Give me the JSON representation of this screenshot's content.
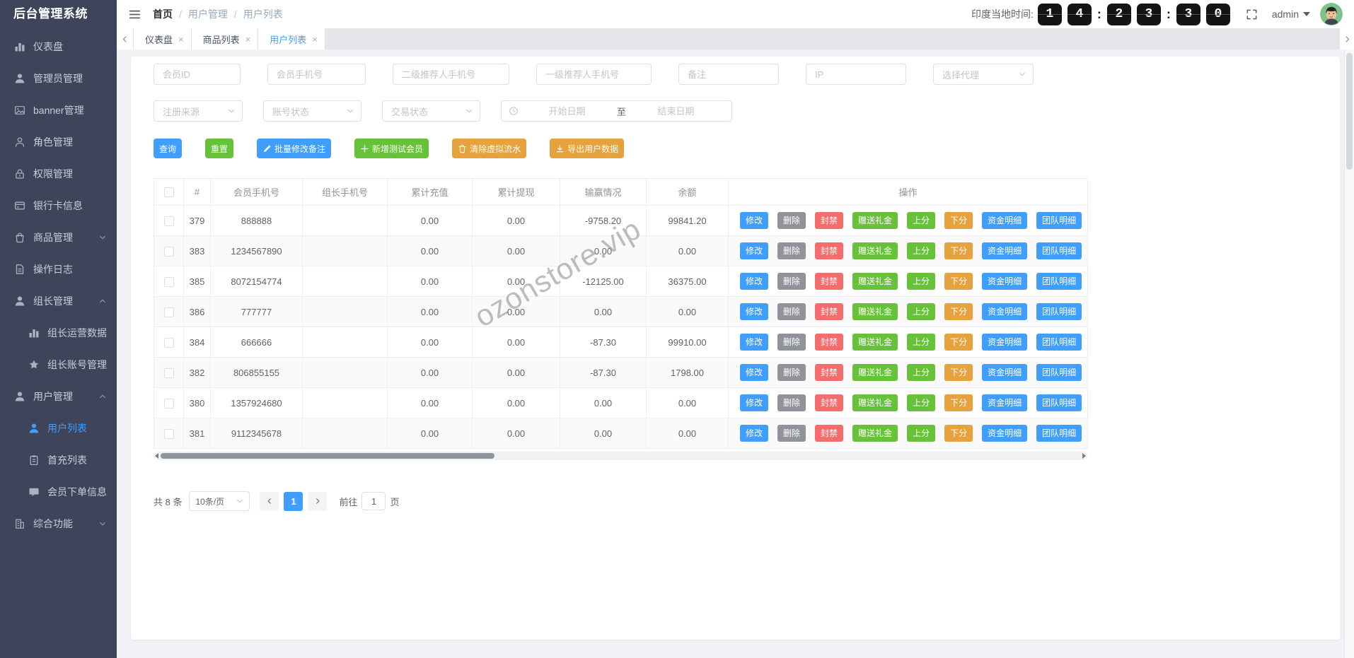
{
  "app": {
    "title": "后台管理系统"
  },
  "sidebar": {
    "items": [
      {
        "label": "仪表盘",
        "icon": "bar-chart-icon"
      },
      {
        "label": "管理员管理",
        "icon": "user-icon"
      },
      {
        "label": "banner管理",
        "icon": "image-icon"
      },
      {
        "label": "角色管理",
        "icon": "user-outline-icon"
      },
      {
        "label": "权限管理",
        "icon": "lock-icon"
      },
      {
        "label": "银行卡信息",
        "icon": "credit-card-icon"
      },
      {
        "label": "商品管理",
        "icon": "shopping-bag-icon",
        "chevron": "down"
      },
      {
        "label": "操作日志",
        "icon": "document-icon"
      },
      {
        "label": "组长管理",
        "icon": "user-icon",
        "chevron": "up"
      },
      {
        "label": "组长运营数据",
        "icon": "bar-chart-icon",
        "sub": true
      },
      {
        "label": "组长账号管理",
        "icon": "star-icon",
        "sub": true
      },
      {
        "label": "用户管理",
        "icon": "user-icon",
        "chevron": "up"
      },
      {
        "label": "用户列表",
        "icon": "user-icon",
        "sub": true,
        "active": true
      },
      {
        "label": "首充列表",
        "icon": "clipboard-icon",
        "sub": true
      },
      {
        "label": "会员下单信息",
        "icon": "message-icon",
        "sub": true
      },
      {
        "label": "综合功能",
        "icon": "building-icon",
        "chevron": "down"
      }
    ]
  },
  "header": {
    "breadcrumb": [
      "首页",
      "用户管理",
      "用户列表"
    ],
    "breadcrumb_separator": "/",
    "time_label": "印度当地时间:",
    "clock": {
      "groups": [
        [
          "1",
          "4"
        ],
        [
          "2",
          "3"
        ],
        [
          "3",
          "0"
        ]
      ],
      "separator": ":"
    },
    "username": "admin"
  },
  "tabs": [
    {
      "label": "仪表盘",
      "active": false
    },
    {
      "label": "商品列表",
      "active": false
    },
    {
      "label": "用户列表",
      "active": true
    }
  ],
  "filters": {
    "text_inputs": [
      "会员ID",
      "会员手机号",
      "二级推荐人手机号",
      "一级推荐人手机号",
      "备注",
      "IP"
    ],
    "agent_select": "选择代理",
    "selects": [
      "注册来源",
      "账号状态",
      "交易状态"
    ],
    "date_range": {
      "start_placeholder": "开始日期",
      "separator": "至",
      "end_placeholder": "结束日期"
    }
  },
  "toolbar": [
    {
      "label": "查询",
      "color": "blue",
      "icon": ""
    },
    {
      "label": "重置",
      "color": "green",
      "icon": ""
    },
    {
      "label": "批量修改备注",
      "color": "blue",
      "icon": "edit-icon"
    },
    {
      "label": "新增测试会员",
      "color": "green",
      "icon": "plus-icon"
    },
    {
      "label": "清除虚拟流水",
      "color": "orange",
      "icon": "trash-icon"
    },
    {
      "label": "导出用户数据",
      "color": "orange",
      "icon": "download-icon"
    }
  ],
  "table": {
    "columns": [
      "#",
      "会员手机号",
      "组长手机号",
      "累计充值",
      "累计提现",
      "输赢情况",
      "余额",
      "操作"
    ],
    "rows": [
      {
        "id": "379",
        "phone": "888888",
        "leader": "",
        "recharge": "0.00",
        "withdraw": "0.00",
        "winloss": "-9758.20",
        "balance": "99841.20"
      },
      {
        "id": "383",
        "phone": "1234567890",
        "leader": "",
        "recharge": "0.00",
        "withdraw": "0.00",
        "winloss": "0.00",
        "balance": "0.00"
      },
      {
        "id": "385",
        "phone": "8072154774",
        "leader": "",
        "recharge": "0.00",
        "withdraw": "0.00",
        "winloss": "-12125.00",
        "balance": "36375.00"
      },
      {
        "id": "386",
        "phone": "777777",
        "leader": "",
        "recharge": "0.00",
        "withdraw": "0.00",
        "winloss": "0.00",
        "balance": "0.00"
      },
      {
        "id": "384",
        "phone": "666666",
        "leader": "",
        "recharge": "0.00",
        "withdraw": "0.00",
        "winloss": "-87.30",
        "balance": "99910.00"
      },
      {
        "id": "382",
        "phone": "806855155",
        "leader": "",
        "recharge": "0.00",
        "withdraw": "0.00",
        "winloss": "-87.30",
        "balance": "1798.00"
      },
      {
        "id": "380",
        "phone": "1357924680",
        "leader": "",
        "recharge": "0.00",
        "withdraw": "0.00",
        "winloss": "0.00",
        "balance": "0.00"
      },
      {
        "id": "381",
        "phone": "9112345678",
        "leader": "",
        "recharge": "0.00",
        "withdraw": "0.00",
        "winloss": "0.00",
        "balance": "0.00"
      }
    ],
    "row_actions": [
      {
        "label": "修改",
        "color": "blue"
      },
      {
        "label": "删除",
        "color": "gray"
      },
      {
        "label": "封禁",
        "color": "red"
      },
      {
        "label": "赠送礼金",
        "color": "green"
      },
      {
        "label": "上分",
        "color": "green"
      },
      {
        "label": "下分",
        "color": "orange"
      },
      {
        "label": "资金明细",
        "color": "blue"
      },
      {
        "label": "团队明细",
        "color": "blue"
      }
    ]
  },
  "watermark": "ozonstore.vip",
  "pagination": {
    "total": "共 8 条",
    "page_size": "10条/页",
    "current_page": "1",
    "goto_label": "前往",
    "goto_value": "1",
    "goto_suffix": "页"
  },
  "colors": {
    "accent_blue": "#409eff",
    "green": "#67c23a",
    "orange": "#e6a23c",
    "red": "#f56c6c",
    "gray": "#909399",
    "sidebar_bg": "#3e4459"
  }
}
